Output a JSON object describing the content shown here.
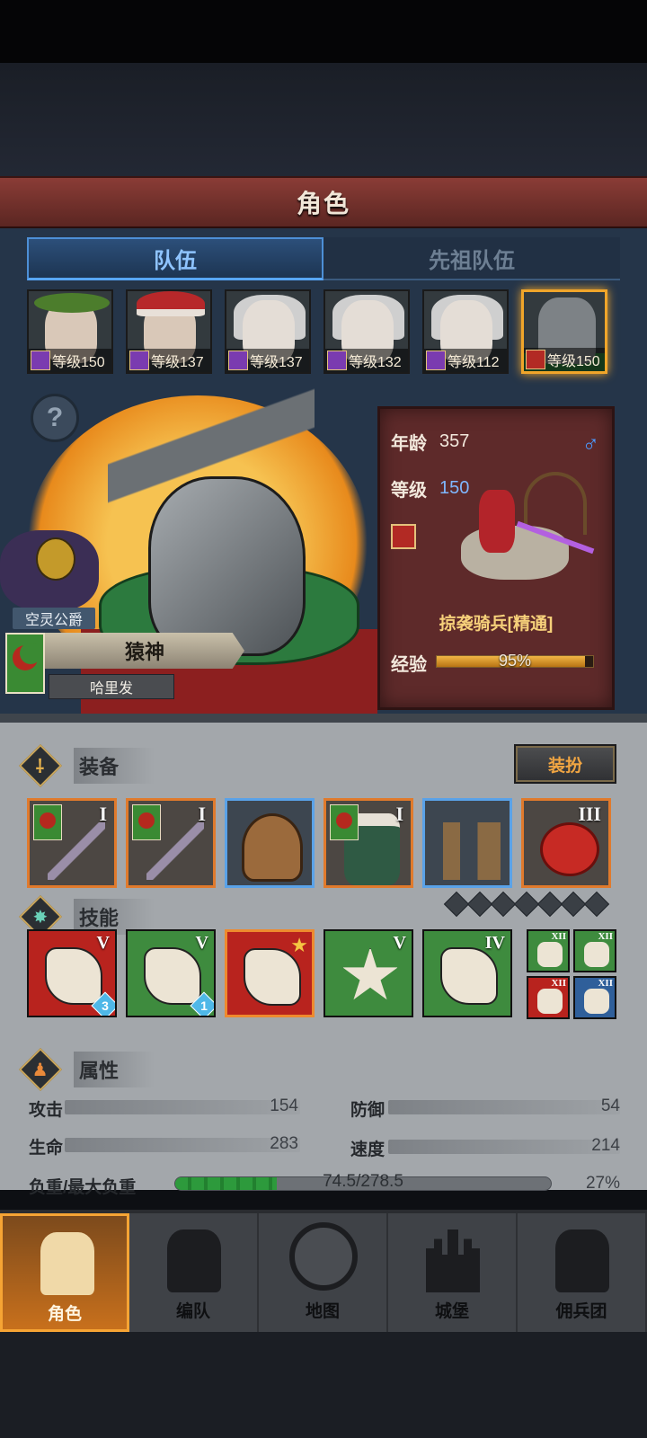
{
  "header": {
    "title": "角色"
  },
  "tabs": [
    {
      "label": "队伍",
      "active": true
    },
    {
      "label": "先祖队伍",
      "active": false
    }
  ],
  "heroes": [
    {
      "level_label": "等级150",
      "look": "wreath",
      "class_color": "purple"
    },
    {
      "level_label": "等级137",
      "look": "santa",
      "class_color": "purple"
    },
    {
      "level_label": "等级137",
      "look": "elf",
      "class_color": "purple"
    },
    {
      "level_label": "等级132",
      "look": "elf",
      "class_color": "purple"
    },
    {
      "level_label": "等级112",
      "look": "elf-beard",
      "class_color": "purple"
    },
    {
      "level_label": "等级150",
      "look": "knight",
      "class_color": "red",
      "selected": true
    }
  ],
  "character": {
    "title_tag": "空灵公爵",
    "name": "猿神",
    "group": "哈里发",
    "help_symbol": "?",
    "age_label": "年龄",
    "age": "357",
    "gender_symbol": "♂",
    "level_label": "等级",
    "level": "150",
    "unit_name": "掠袭骑兵[精通]",
    "exp_label": "经验",
    "exp_text": "95%",
    "exp_fraction": 0.95
  },
  "equipment": {
    "label": "装备",
    "icon": "⸸",
    "dress_button": "装扮",
    "slots": [
      {
        "tier": "I",
        "type": "sword",
        "frame": "orange",
        "flag": true
      },
      {
        "tier": "I",
        "type": "sword",
        "frame": "orange",
        "flag": true
      },
      {
        "tier": "",
        "type": "helmet",
        "frame": "blue",
        "flag": false
      },
      {
        "tier": "I",
        "type": "armor",
        "frame": "orange",
        "flag": true
      },
      {
        "tier": "",
        "type": "boots",
        "frame": "blue",
        "flag": false
      },
      {
        "tier": "III",
        "type": "emblem",
        "frame": "orange",
        "flag": false
      }
    ]
  },
  "skills": {
    "label": "技能",
    "icon": "✸",
    "slots_filled": 0,
    "slots_total": 7,
    "list": [
      {
        "tier": "V",
        "color": "red",
        "badge": "3"
      },
      {
        "tier": "V",
        "color": "green",
        "badge": "1"
      },
      {
        "tier": "",
        "color": "red",
        "star": true,
        "selected": true
      },
      {
        "tier": "V",
        "color": "green"
      },
      {
        "tier": "IV",
        "color": "green"
      }
    ],
    "mini": [
      {
        "tier": "XII",
        "color": "green"
      },
      {
        "tier": "XII",
        "color": "green"
      },
      {
        "tier": "XII",
        "color": "red"
      },
      {
        "tier": "XII",
        "color": "blue"
      }
    ]
  },
  "attributes": {
    "label": "属性",
    "icon": "♟",
    "attack_label": "攻击",
    "attack": "154",
    "defense_label": "防御",
    "defense": "54",
    "hp_label": "生命",
    "hp": "283",
    "speed_label": "速度",
    "speed": "214",
    "load_label": "负重/最大负重",
    "load_text": "74.5/278.5",
    "load_percent": "27%",
    "load_fraction": 0.27
  },
  "nav": [
    {
      "label": "角色",
      "active": true
    },
    {
      "label": "编队",
      "active": false
    },
    {
      "label": "地图",
      "active": false
    },
    {
      "label": "城堡",
      "active": false
    },
    {
      "label": "佣兵团",
      "active": false
    }
  ],
  "colors": {
    "title_bar": "#8a3c36",
    "tab_active": "#58a7ff",
    "selected_frame": "#f0a52a",
    "exp_fill": "#f0b545",
    "load_fill": "#2d9a3c"
  }
}
